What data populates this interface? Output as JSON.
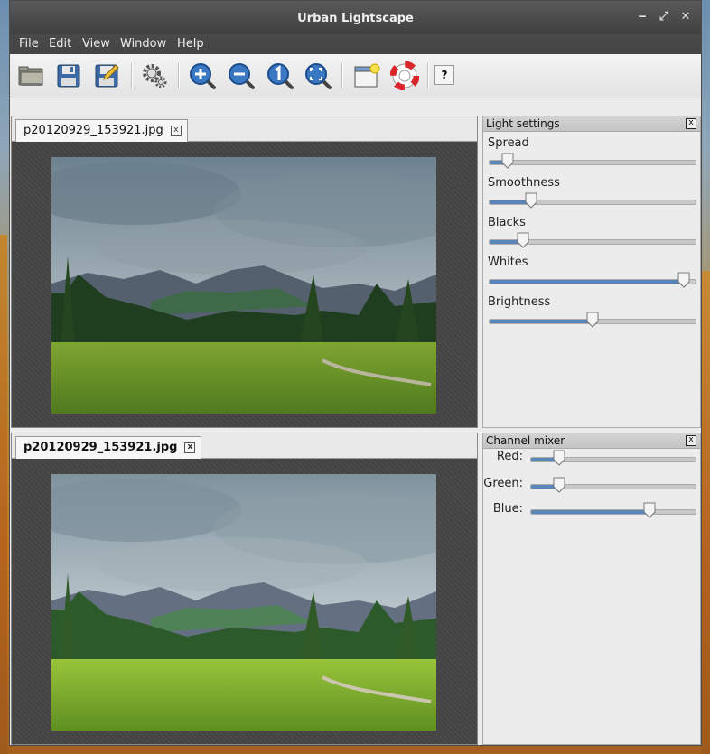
{
  "window": {
    "title": "Urban Lightscape"
  },
  "window_controls": {
    "minimize": "‒",
    "maximize": "⤢",
    "close": "✕"
  },
  "menu": [
    "File",
    "Edit",
    "View",
    "Window",
    "Help"
  ],
  "toolbar": {
    "buttons": [
      "open-icon",
      "save-icon",
      "save-as-icon",
      "settings-icon",
      "zoom-in-icon",
      "zoom-out-icon",
      "zoom-actual-icon",
      "zoom-fit-icon",
      "new-window-icon",
      "help-lifebuoy-icon",
      "whats-this-icon"
    ],
    "whats_this_label": "?"
  },
  "tabs": {
    "top": {
      "label": "p20120929_153921.jpg",
      "close": "x"
    },
    "bottom": {
      "label": "p20120929_153921.jpg",
      "close": "x"
    }
  },
  "light_settings": {
    "title": "Light settings",
    "close": "x",
    "sliders": [
      {
        "label": "Spread",
        "value": 0.06
      },
      {
        "label": "Smoothness",
        "value": 0.18
      },
      {
        "label": "Blacks",
        "value": 0.14
      },
      {
        "label": "Whites",
        "value": 0.97
      },
      {
        "label": "Brightness",
        "value": 0.5
      }
    ]
  },
  "channel_mixer": {
    "title": "Channel mixer",
    "close": "x",
    "sliders": [
      {
        "label": "Red:",
        "value": 0.14
      },
      {
        "label": "Green:",
        "value": 0.14
      },
      {
        "label": "Blue:",
        "value": 0.74
      }
    ]
  },
  "colors": {
    "accent": "#5a85b8",
    "titlebar": "#444444"
  }
}
